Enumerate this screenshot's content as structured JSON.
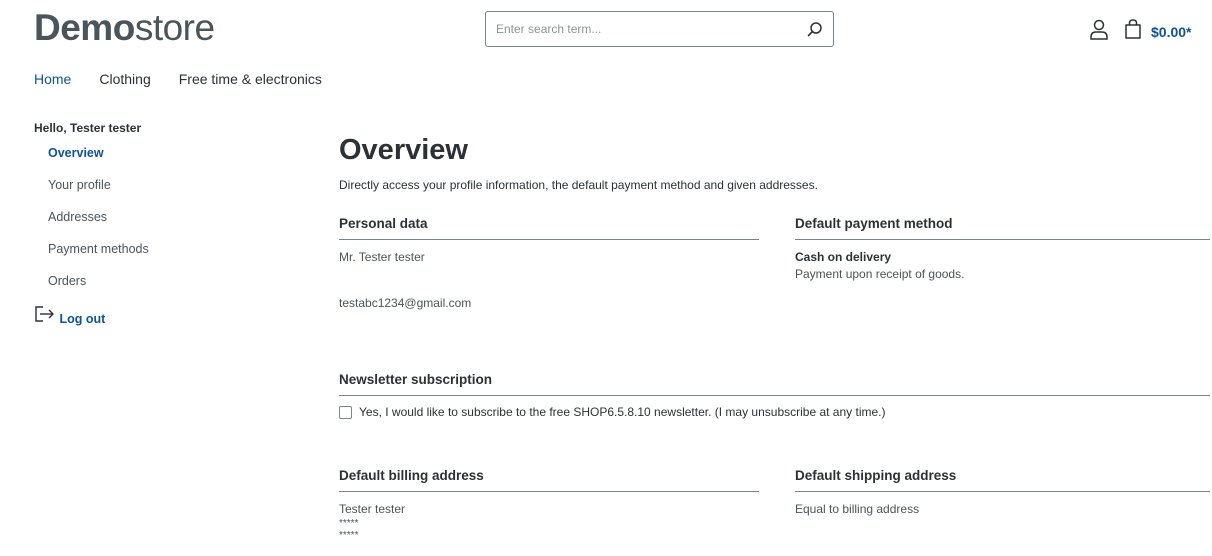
{
  "header": {
    "logo_bold": "Demo",
    "logo_light": "store",
    "search_placeholder": "Enter search term...",
    "cart_total": "$0.00*"
  },
  "nav": {
    "items": [
      "Home",
      "Clothing",
      "Free time & electronics"
    ]
  },
  "sidebar": {
    "greeting": "Hello, Tester tester",
    "items": [
      "Overview",
      "Your profile",
      "Addresses",
      "Payment methods",
      "Orders"
    ],
    "logout": "Log out"
  },
  "main": {
    "title": "Overview",
    "subtitle": "Directly access your profile information, the default payment method and given addresses.",
    "personal": {
      "heading": "Personal data",
      "name": "Mr. Tester tester",
      "email": "testabc1234@gmail.com"
    },
    "payment": {
      "heading": "Default payment method",
      "method": "Cash on delivery",
      "description": "Payment upon receipt of goods."
    },
    "newsletter": {
      "heading": "Newsletter subscription",
      "label": "Yes, I would like to subscribe to the free SHOP6.5.8.10 newsletter. (I may unsubscribe at any time.)"
    },
    "billing": {
      "heading": "Default billing address",
      "name": "Tester tester",
      "line1": "*****",
      "line2": "*****"
    },
    "shipping": {
      "heading": "Default shipping address",
      "text": "Equal to billing address"
    }
  },
  "colors": {
    "accent": "#0b539b",
    "text": "#2b3136",
    "border": "#798490"
  }
}
